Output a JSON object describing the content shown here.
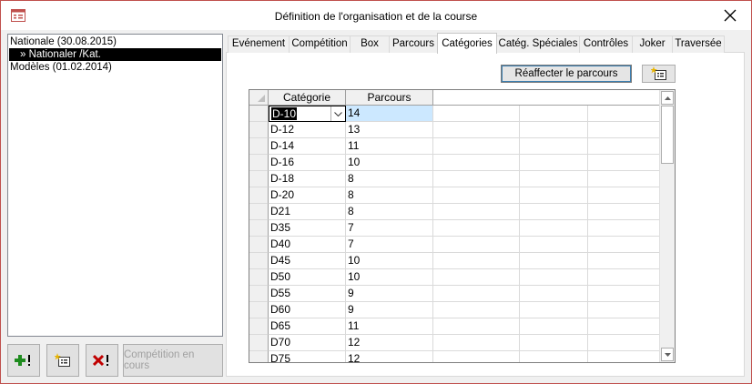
{
  "window": {
    "title": "Définition de l'organisation et de la course"
  },
  "tree": {
    "items": [
      {
        "label": "Nationale (30.08.2015)"
      },
      {
        "label": "» Nationaler /Kat."
      },
      {
        "label": "Modèles (01.02.2014)"
      }
    ]
  },
  "buttons": {
    "competition_label": "Compétition en cours"
  },
  "tabs": [
    {
      "label": "Evénement"
    },
    {
      "label": "Compétition"
    },
    {
      "label": "Box"
    },
    {
      "label": "Parcours"
    },
    {
      "label": "Catégories"
    },
    {
      "label": "Catég. Spéciales"
    },
    {
      "label": "Contrôles"
    },
    {
      "label": "Joker"
    },
    {
      "label": "Traversée"
    }
  ],
  "toolbar": {
    "reassign_label": "Réaffecter le parcours"
  },
  "grid": {
    "headers": [
      "Catégorie",
      "Parcours"
    ],
    "rows": [
      {
        "category": "D-10",
        "course": "14"
      },
      {
        "category": "D-12",
        "course": "13"
      },
      {
        "category": "D-14",
        "course": "11"
      },
      {
        "category": "D-16",
        "course": "10"
      },
      {
        "category": "D-18",
        "course": "8"
      },
      {
        "category": "D-20",
        "course": "8"
      },
      {
        "category": "D21",
        "course": "8"
      },
      {
        "category": "D35",
        "course": "7"
      },
      {
        "category": "D40",
        "course": "7"
      },
      {
        "category": "D45",
        "course": "10"
      },
      {
        "category": "D50",
        "course": "10"
      },
      {
        "category": "D55",
        "course": "9"
      },
      {
        "category": "D60",
        "course": "9"
      },
      {
        "category": "D65",
        "course": "11"
      },
      {
        "category": "D70",
        "course": "12"
      },
      {
        "category": "D75",
        "course": "12"
      }
    ]
  },
  "colors": {
    "accent": "#c0504d",
    "selection": "#000000",
    "cell_highlight": "#cce8ff"
  }
}
